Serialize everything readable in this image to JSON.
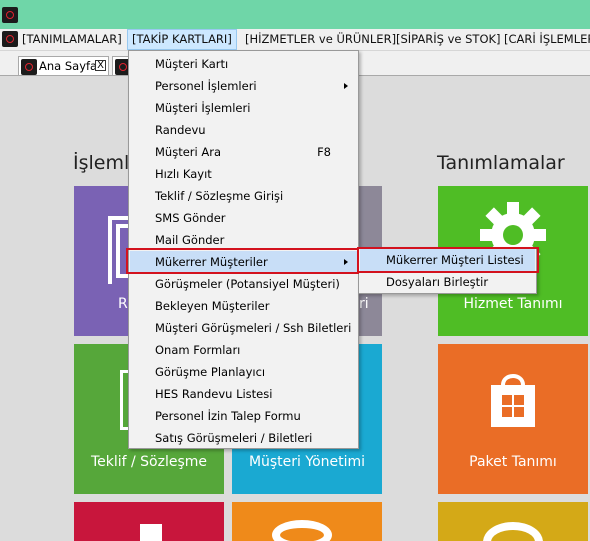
{
  "menubar": {
    "items": [
      "[TANIMLAMALAR]",
      "[TAKİP KARTLARI]",
      "[HİZMETLER ve ÜRÜNLER]",
      "[SİPARİŞ ve STOK]",
      "[CARİ İŞLEMLER]"
    ]
  },
  "tabs": {
    "home": "Ana Sayfa",
    "close": "X"
  },
  "sections": {
    "left_partial": "İşleml",
    "right": "Tanımlamalar"
  },
  "tiles": {
    "left_mid_partial": "R",
    "left_mid2_partial": "ri",
    "hizmet": "Hizmet Tanımı",
    "teklif": "Teklif / Sözleşme",
    "musteri_yonetimi": "Müşteri Yönetimi",
    "paket": "Paket Tanımı"
  },
  "colors": {
    "titlebar": "#6fd6a8",
    "highlight_border": "#d3121e",
    "tile_purple": "#7a62b4",
    "tile_green": "#56a73a",
    "tile_cyan": "#1aa9d2",
    "tile_orange": "#ea6d26",
    "tile_red": "#c8163c",
    "tile_yellow": "#d4a917"
  },
  "dropdown": {
    "items": [
      {
        "label": "Müşteri Kartı"
      },
      {
        "label": "Personel İşlemleri",
        "submenu": true
      },
      {
        "label": "Müşteri İşlemleri"
      },
      {
        "label": "Randevu"
      },
      {
        "label": "Müşteri Ara",
        "shortcut": "F8"
      },
      {
        "label": "Hızlı Kayıt"
      },
      {
        "label": "Teklif / Sözleşme Girişi"
      },
      {
        "label": "SMS Gönder"
      },
      {
        "label": "Mail Gönder"
      },
      {
        "label": "Mükerrer Müşteriler",
        "submenu": true,
        "highlighted": true
      },
      {
        "label": "Görüşmeler (Potansiyel Müşteri)"
      },
      {
        "label": "Bekleyen Müşteriler"
      },
      {
        "label": "Müşteri Görüşmeleri / Ssh Biletleri"
      },
      {
        "label": "Onam Formları"
      },
      {
        "label": "Görüşme Planlayıcı"
      },
      {
        "label": "HES Randevu Listesi"
      },
      {
        "label": "Personel İzin Talep Formu"
      },
      {
        "label": "Satış Görüşmeleri / Biletleri"
      }
    ]
  },
  "submenu": {
    "items": [
      {
        "label": "Mükerrer Müşteri Listesi",
        "highlighted": true
      },
      {
        "label": "Dosyaları Birleştir"
      }
    ]
  }
}
